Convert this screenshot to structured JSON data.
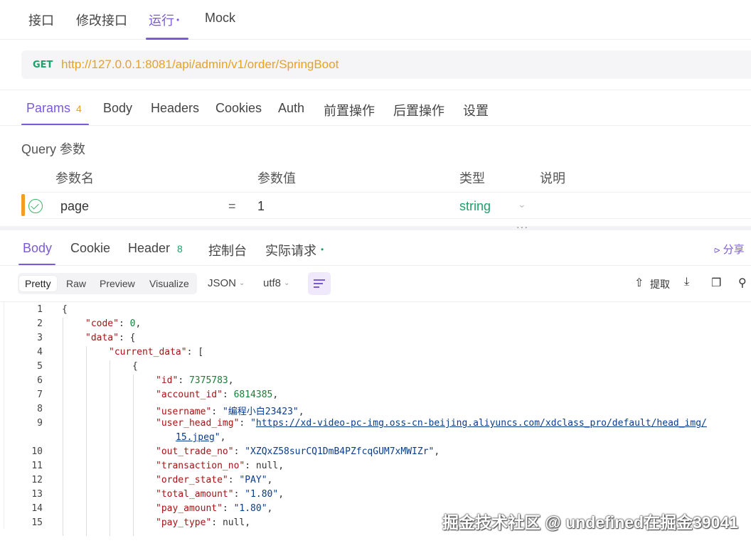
{
  "top_tabs": [
    {
      "label": "接口"
    },
    {
      "label": "修改接口"
    },
    {
      "label": "运行",
      "dot": "•"
    },
    {
      "label": "Mock"
    }
  ],
  "request": {
    "method": "GET",
    "url": "http://127.0.0.1:8081/api/admin/v1/order/SpringBoot"
  },
  "request_tabs": [
    {
      "label": "Params",
      "badge": "4"
    },
    {
      "label": "Body"
    },
    {
      "label": "Headers"
    },
    {
      "label": "Cookies"
    },
    {
      "label": "Auth"
    },
    {
      "label": "前置操作"
    },
    {
      "label": "后置操作"
    },
    {
      "label": "设置"
    }
  ],
  "query": {
    "label": "Query 参数",
    "columns": [
      "参数名",
      "参数值",
      "类型",
      "说明"
    ],
    "rows": [
      {
        "name": "page",
        "eq": "=",
        "value": "1",
        "type": "string"
      }
    ]
  },
  "splitter_handle": "···",
  "response_tabs": [
    {
      "label": "Body"
    },
    {
      "label": "Cookie"
    },
    {
      "label": "Header",
      "badge": "8"
    },
    {
      "label": "控制台"
    },
    {
      "label": "实际请求",
      "dot": "•"
    }
  ],
  "share_label": "分享",
  "view_modes": [
    "Pretty",
    "Raw",
    "Preview",
    "Visualize"
  ],
  "format_select": "JSON",
  "encoding_select": "utf8",
  "extract_label": "提取",
  "code_lines": [
    {
      "n": "1",
      "t": "{"
    },
    {
      "n": "2",
      "t": "\"code\": 0,"
    },
    {
      "n": "3",
      "t": "\"data\": {"
    },
    {
      "n": "4",
      "t": "\"current_data\": ["
    },
    {
      "n": "5",
      "t": "{"
    },
    {
      "n": "6",
      "t": "\"id\": 7375783,"
    },
    {
      "n": "7",
      "t": "\"account_id\": 6814385,"
    },
    {
      "n": "8",
      "t": "\"username\": \"编程小白23423\","
    },
    {
      "n": "9",
      "t": "\"user_head_img\": \"https://xd-video-pc-img.oss-cn-beijing.aliyuncs.com/xdclass_pro/default/head_img/"
    },
    {
      "n": "",
      "t": "15.jpeg\","
    },
    {
      "n": "10",
      "t": "\"out_trade_no\": \"XZQxZ58surCQ1DmB4PZfcqGUM7xMWIZr\","
    },
    {
      "n": "11",
      "t": "\"transaction_no\": null,"
    },
    {
      "n": "12",
      "t": "\"order_state\": \"PAY\","
    },
    {
      "n": "13",
      "t": "\"total_amount\": \"1.80\","
    },
    {
      "n": "14",
      "t": "\"pay_amount\": \"1.80\","
    },
    {
      "n": "15",
      "t": "\"pay_type\": null,"
    }
  ],
  "code": {
    "key_code": "\"code\"",
    "val_code": "0",
    "key_data": "\"data\"",
    "key_current": "\"current_data\"",
    "key_id": "\"id\"",
    "val_id": "7375783",
    "key_account": "\"account_id\"",
    "val_account": "6814385",
    "key_username": "\"username\"",
    "val_username": "\"编程小白23423\"",
    "key_head": "\"user_head_img\"",
    "val_head_1": "https://xd-video-pc-img.oss-cn-beijing.aliyuncs.com/xdclass_pro/default/head_img/",
    "val_head_2": "15.jpeg",
    "key_trade": "\"out_trade_no\"",
    "val_trade": "\"XZQxZ58surCQ1DmB4PZfcqGUM7xMWIZr\"",
    "key_trans": "\"transaction_no\"",
    "val_trans": "null",
    "key_state": "\"order_state\"",
    "val_state": "\"PAY\"",
    "key_total": "\"total_amount\"",
    "val_total": "\"1.80\"",
    "key_pay": "\"pay_amount\"",
    "val_pay": "\"1.80\"",
    "key_paytype": "\"pay_type\"",
    "val_paytype": "null"
  },
  "watermark": "掘金技术社区 @ undefined在掘金39041"
}
